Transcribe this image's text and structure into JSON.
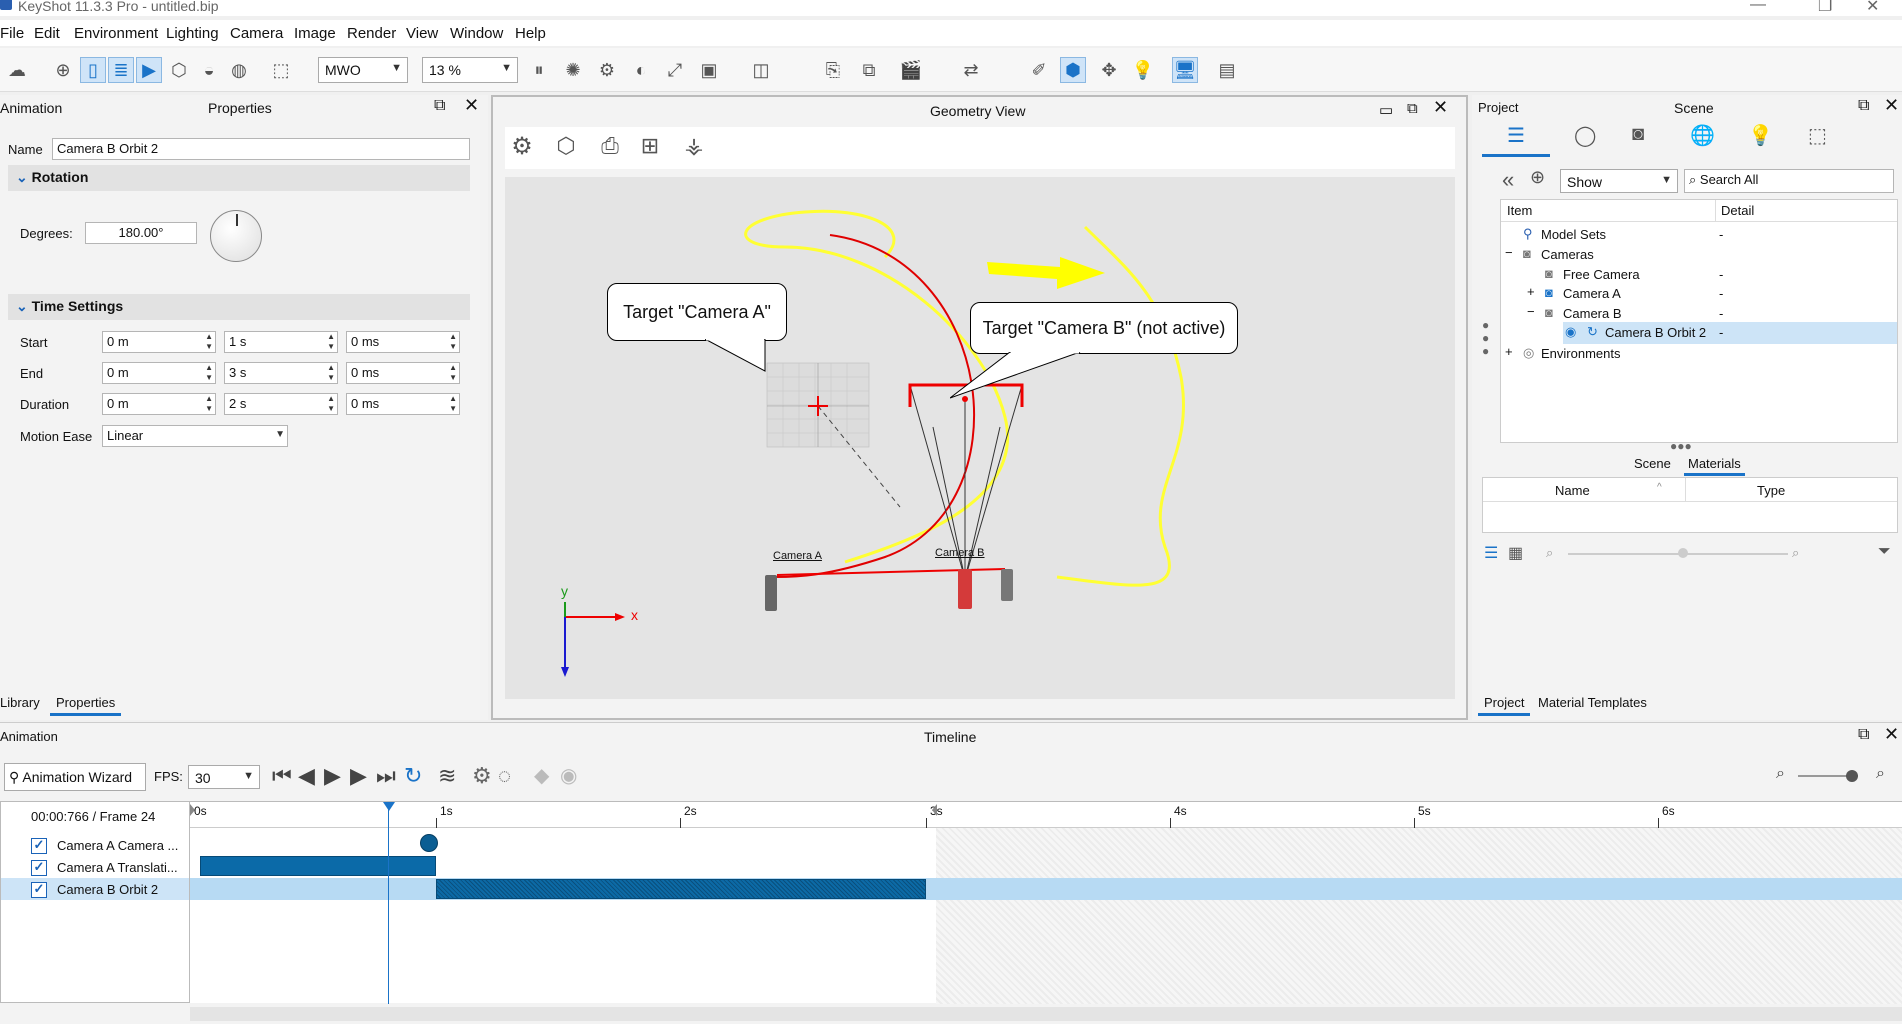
{
  "app": {
    "title": "KeyShot 11.3.3 Pro  - untitled.bip"
  },
  "menu": [
    "File",
    "Edit",
    "Environment",
    "Lighting",
    "Camera",
    "Image",
    "Render",
    "View",
    "Window",
    "Help"
  ],
  "toolbar": {
    "mwo": "MWO",
    "zoom": "13 %"
  },
  "left_panel": {
    "tab_left": "Animation",
    "title": "Properties",
    "name_label": "Name",
    "name_value": "Camera B Orbit 2",
    "rotation": "Rotation",
    "degrees_label": "Degrees:",
    "degrees_value": "180.00°",
    "time_settings": "Time Settings",
    "start_label": "Start",
    "end_label": "End",
    "duration_label": "Duration",
    "start": [
      "0 m",
      "1 s",
      "0 ms"
    ],
    "end": [
      "0 m",
      "3 s",
      "0 ms"
    ],
    "duration": [
      "0 m",
      "2 s",
      "0 ms"
    ],
    "motion_ease_label": "Motion Ease",
    "motion_ease": "Linear",
    "bottom_tabs": [
      "Library",
      "Properties"
    ]
  },
  "geometry_view": {
    "title": "Geometry View",
    "callout_a": "Target \"Camera A\"",
    "callout_b": "Target \"Camera B\" (not active)",
    "cam_a_label": "Camera A",
    "cam_b_label": "Camera B",
    "axis_x": "x",
    "axis_y": "y"
  },
  "right_panel": {
    "tab_left": "Project",
    "title": "Scene",
    "show": "Show",
    "search_placeholder": "Search All",
    "col_item": "Item",
    "col_detail": "Detail",
    "tree": [
      {
        "label": "Model Sets",
        "detail": "-"
      },
      {
        "label": "Cameras",
        "detail": ""
      },
      {
        "label": "Free Camera",
        "detail": "-"
      },
      {
        "label": "Camera A",
        "detail": "-"
      },
      {
        "label": "Camera B",
        "detail": "-"
      },
      {
        "label": "Camera B Orbit 2",
        "detail": "-"
      },
      {
        "label": "Environments",
        "detail": ""
      }
    ],
    "sub_tabs": [
      "Scene",
      "Materials"
    ],
    "col_name": "Name",
    "col_type": "Type",
    "bottom_tabs": [
      "Project",
      "Material Templates"
    ]
  },
  "timeline": {
    "tab_left": "Animation",
    "title": "Timeline",
    "wizard": "Animation Wizard",
    "fps_label": "FPS:",
    "fps": "30",
    "time_readout": "00:00:766 / Frame 24",
    "ticks": [
      "0s",
      "1s",
      "2s",
      "3s",
      "4s",
      "5s",
      "6s"
    ],
    "rows": [
      "Camera A Camera ...",
      "Camera A Translati...",
      "Camera B Orbit 2"
    ]
  }
}
